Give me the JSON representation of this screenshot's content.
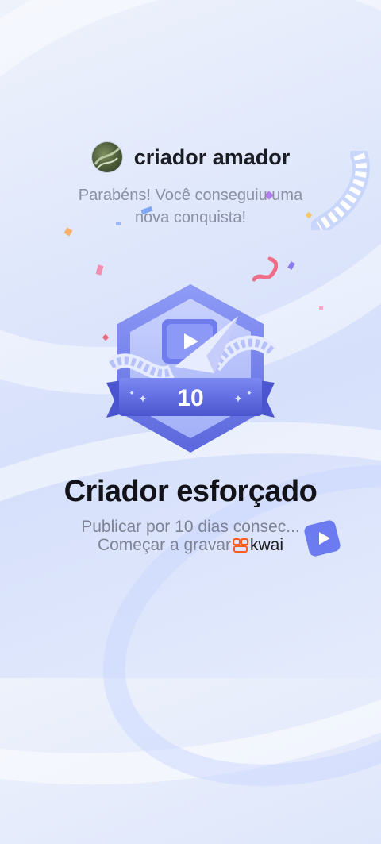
{
  "header": {
    "username": "criador amador"
  },
  "message": {
    "line1": "Parabéns! Você conseguiu uma",
    "line2": "nova conquista!"
  },
  "badge": {
    "number": "10"
  },
  "achievement": {
    "title": "Criador esforçado",
    "description": "Publicar por 10 dias consec...",
    "cta": "Começar a gravar",
    "brand": "kwai"
  },
  "colors": {
    "accent": "#5b6ce8",
    "brand": "#ff5a1f",
    "title": "#121218",
    "muted": "#8a8fa3"
  }
}
